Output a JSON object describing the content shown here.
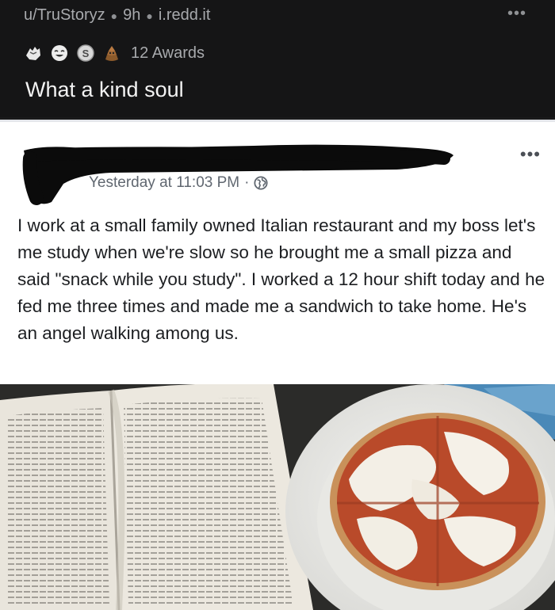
{
  "reddit": {
    "subreddit_user": "u/TruStoryz",
    "age": "9h",
    "domain": "i.redd.it",
    "more_label": "•••",
    "awards_count": "12 Awards",
    "award_icons": [
      "hand-award-icon",
      "laughing-award-icon",
      "silver-coin-award-icon",
      "pile-award-icon"
    ],
    "title": "What a kind soul"
  },
  "facebook_post": {
    "time": "Yesterday at 11:03 PM",
    "separator": "·",
    "more_label": "•••",
    "privacy_icon": "globe-icon",
    "text": "I work at a small family owned Italian restaurant and my boss let's me study when we're slow so he brought me a small pizza and said \"snack while you study\". I worked a 12 hour shift today and he fed me three times and made me a sandwich to take home. He's an angel walking among us."
  },
  "colors": {
    "reddit_bg": "#151516",
    "card_bg": "#ffffff",
    "text_dark": "#1c1e21",
    "meta_gray": "#a8aaad"
  }
}
